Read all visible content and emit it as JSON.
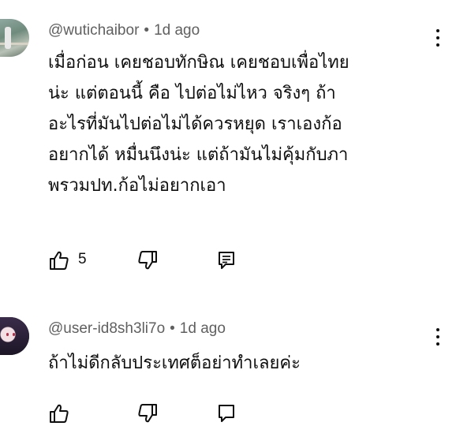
{
  "comments": [
    {
      "author": "@wutichaibor",
      "separator": "•",
      "time": "1d ago",
      "lines": [
        "เมื่อก่อน เคยชอบทักษิณ  เคยชอบเพื่อไทย",
        "น่ะ  แต่ตอนนี้ คือ ไปต่อไม่ไหว จริงๆ ถ้า",
        "อะไรที่มันไปต่อไม่ได้ควรหยุด เราเองก้อ",
        "อยากได้ หมื่นนึงน่ะ แต่ถ้ามันไม่คุ้มกับภา",
        "พรวมปท.ก้อไม่อยากเอา"
      ],
      "like_count": "5",
      "avatar_icon": "avatar-photo-person-railing",
      "like_icon": "thumbs-up-icon",
      "dislike_icon": "thumbs-down-icon",
      "reply_icon": "reply-comment-icon",
      "menu_icon": "more-vertical-icon"
    },
    {
      "author": "@user-id8sh3li7o",
      "separator": "•",
      "time": "1d ago",
      "lines": [
        "ถ้าไม่ดีกลับประเทศต็อย่าทำเลยค่ะ"
      ],
      "avatar_icon": "avatar-anime-character",
      "menu_icon": "more-vertical-icon"
    }
  ]
}
